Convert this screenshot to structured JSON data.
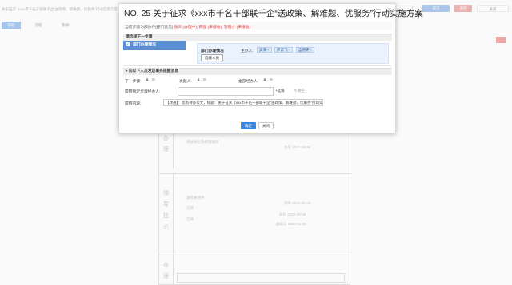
{
  "background": {
    "title": "关于征求《xxx市千名干部联千企“送政策、解难题、优服务”行动实施方案》意见的通知",
    "buttons": [
      "提交",
      "退回",
      "关闭"
    ],
    "tabs": [
      "审批",
      "流程",
      "附件"
    ],
    "rows": [
      {
        "label": [
          "办",
          "理"
        ],
        "org": "测试单位系统管理局",
        "sig": "主任 2022-06-28"
      },
      {
        "label": [
          "领",
          "导",
          "批",
          "示"
        ],
        "org": "请有关领导",
        "status": "已阅",
        "status2": "已阅",
        "sig1": "领导 2022-06-28",
        "sig2": "局长 2022-06-28",
        "sig3": "副局长 2022-06-28"
      },
      {
        "label": [
          "办",
          "理"
        ]
      }
    ]
  },
  "modal": {
    "title": "NO. 25 关于征求《xxx市千名干部联千企“送政策、解难题、优服务”行动实施方案",
    "current_step_prefix": "当前步骤为部办件[部门意见]",
    "current_step_highlight": "张三 (办理中), 韩强 (未接收), 刘晓才 (未接收)",
    "next_step_header": "请选择下一步骤",
    "step_name": "部门办理情况",
    "select_button": "选择人员",
    "host_label": "主办人:",
    "hosts": [
      "吴海",
      "伊云飞",
      "孟德夫"
    ],
    "notice_header": "向以下人员发送事务提醒消息",
    "next_step_label": "下一步骤:",
    "sender_label": "发起人:",
    "all_handlers_label": "全部经办人:",
    "remind_label": "提醒指定步骤经办人:",
    "choose_label": "选择",
    "clear_label": "清空",
    "content_label": "提醒内容:",
    "content_value": "【政通】：您有待办公文，标题：关于征求《xxx市千名干部联千企“送政策、解难题、优服务”行动实施",
    "ok_label": "确定",
    "close_label": "关闭"
  }
}
